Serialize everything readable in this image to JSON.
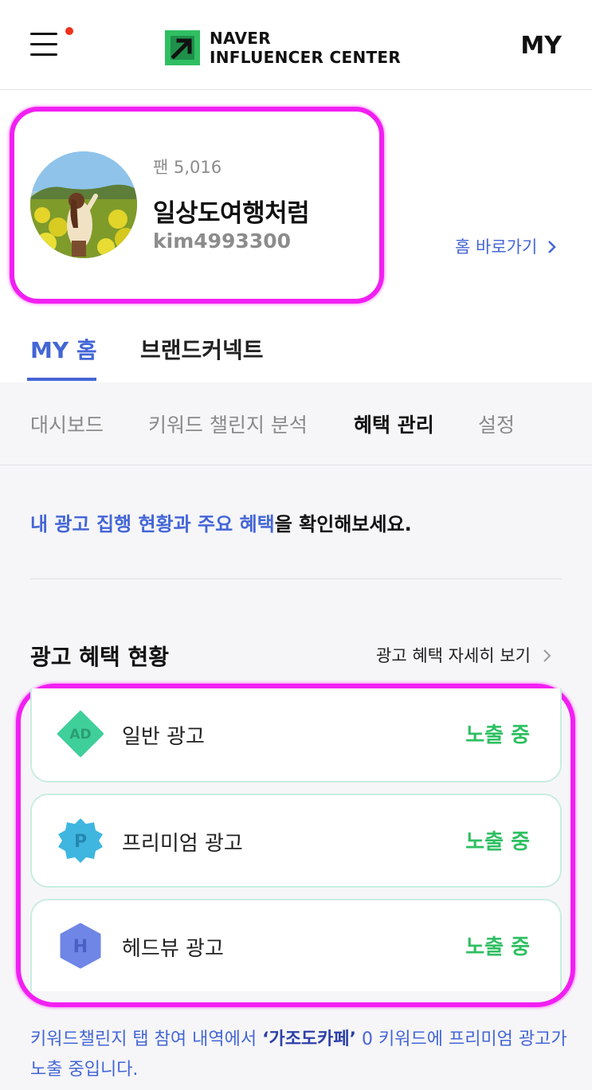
{
  "header": {
    "logo_line1": "NAVER",
    "logo_line2": "INFLUENCER CENTER",
    "my_label": "MY",
    "brand_color": "#2fbf62",
    "notification_dot_color": "#f0301e"
  },
  "profile": {
    "fan_label": "팬 5,016",
    "nickname": "일상도여행처럼",
    "user_id": "kim4993300",
    "home_link": "홈 바로가기"
  },
  "tabs": [
    {
      "label": "MY 홈",
      "active": true
    },
    {
      "label": "브랜드커넥트",
      "active": false
    }
  ],
  "subtabs": [
    {
      "label": "대시보드",
      "active": false
    },
    {
      "label": "키워드 챌린지 분석",
      "active": false
    },
    {
      "label": "혜택 관리",
      "active": true
    },
    {
      "label": "설정",
      "active": false
    }
  ],
  "intro": {
    "highlight": "내 광고 집행 현황과 주요 혜택",
    "rest": "을 확인해보세요."
  },
  "ad_section": {
    "title": "광고 혜택 현황",
    "detail_link": "광고 혜택 자세히 보기",
    "items": [
      {
        "name": "일반 광고",
        "status": "노출 중",
        "icon": "ad-diamond-icon",
        "icon_letter": "AD",
        "icon_color": "#3fcf9a"
      },
      {
        "name": "프리미엄 광고",
        "status": "노출 중",
        "icon": "premium-badge-icon",
        "icon_letter": "P",
        "icon_color": "#3fb6e0"
      },
      {
        "name": "헤드뷰 광고",
        "status": "노출 중",
        "icon": "headview-hexagon-icon",
        "icon_letter": "H",
        "icon_color": "#6f86e6"
      }
    ],
    "status_color": "#2fbf62"
  },
  "footnote": {
    "prefix": "키워드챌린지 탭 참여 내역에서 ",
    "keyword": "‘가조도카페’",
    "suffix": " 0 키워드에 프리미엄 광고가 노출 중입니다."
  },
  "accent_color": "#4466d6",
  "annotation_color": "#f21ff2"
}
